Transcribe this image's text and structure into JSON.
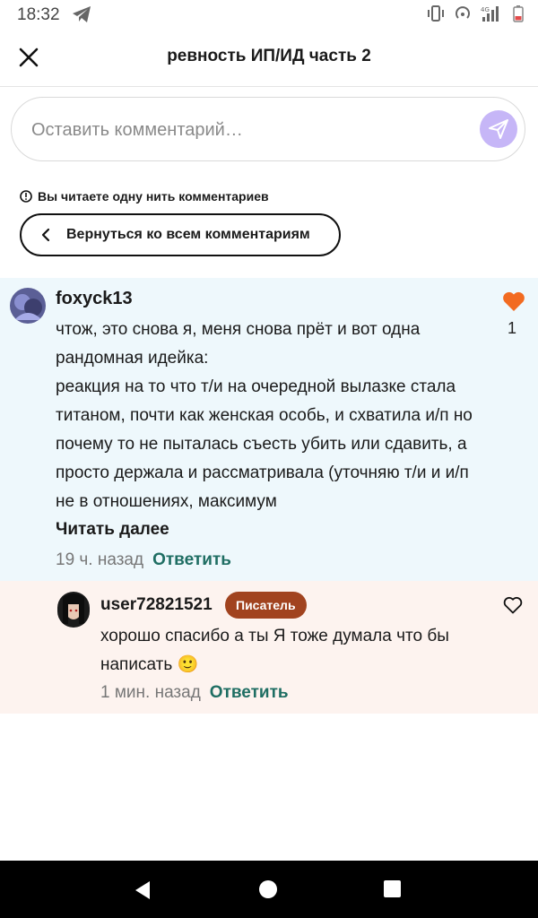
{
  "status_bar": {
    "time": "18:32"
  },
  "header": {
    "title": "ревность ИП/ИД часть 2"
  },
  "comment_input": {
    "placeholder": "Оставить комментарий…"
  },
  "thread": {
    "notice": "Вы читаете одну нить комментариев",
    "back_label": "Вернуться ко всем комментариям"
  },
  "comment": {
    "username": "foxyck13",
    "text": "чтож, это снова я, меня снова прёт и вот одна рандомная идейка:\nреакция на то что т/и на очередной вылазке стала титаном, почти как женская особь, и схватила и/п но почему то не пыталась съесть убить или сдавить, а просто держала и рассматривала (уточняю т/и и и/п не в отношениях, максимум",
    "read_more": "Читать далее",
    "time": "19 ч. назад",
    "reply_label": "Ответить",
    "likes": "1",
    "liked": true
  },
  "reply": {
    "username": "user72821521",
    "badge": "Писатель",
    "text": "хорошо спасибо  а ты Я тоже думала что бы написать 🙂",
    "time": "1 мин. назад",
    "reply_label": "Ответить",
    "liked": false
  },
  "colors": {
    "accent_reply": "#1f6e63",
    "badge": "#a1431f",
    "heart": "#f26b21",
    "send": "#c6b6f7",
    "comment_bg": "#eef8fc",
    "reply_bg": "#fdf3ef"
  },
  "icons": {
    "status_left": "telegram-icon",
    "status_right": [
      "vibrate-icon",
      "hotspot-icon",
      "signal-icon",
      "battery-icon"
    ],
    "close": "close-icon",
    "send": "send-icon",
    "notice": "info-icon",
    "back": "chevron-left-icon",
    "like": "heart-icon",
    "nav": [
      "back-triangle-icon",
      "home-circle-icon",
      "recents-square-icon"
    ]
  }
}
